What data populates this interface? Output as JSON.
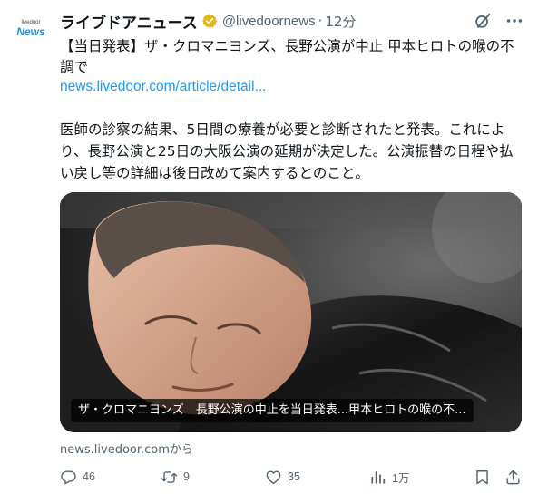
{
  "account": {
    "avatar_small": "livedoor",
    "avatar_big": "News",
    "name": "ライブドアニュース",
    "handle": "@livedoornews",
    "separator": "·",
    "time": "12分"
  },
  "tweet": {
    "title": "【当日発表】ザ・クロマニヨンズ、長野公演が中止 甲本ヒロトの喉の不調で",
    "link": "news.livedoor.com/article/detail...",
    "body": "医師の診察の結果、5日間の療養が必要と診断されたと発表。これにより、長野公演と25日の大阪公演の延期が決定した。公演振替の日程や払い戻し等の詳細は後日改めて案内するとのこと。"
  },
  "card": {
    "caption": "ザ・クロマニヨンズ　長野公演の中止を当日発表...甲本ヒロトの喉の不...",
    "from": "news.livedoor.comから"
  },
  "actions": {
    "reply_count": "46",
    "retweet_count": "9",
    "like_count": "35",
    "views_count": "1万"
  },
  "icons": {
    "verified": "verified-badge-icon",
    "grok": "grok-icon",
    "more": "more-icon",
    "reply": "reply-icon",
    "retweet": "retweet-icon",
    "like": "heart-icon",
    "views": "views-icon",
    "bookmark": "bookmark-icon",
    "share": "share-icon"
  },
  "colors": {
    "link": "#1d9bf0",
    "secondary_text": "#536471",
    "verified_gold": "#e2b719",
    "brand_blue": "#1a8fd8"
  }
}
